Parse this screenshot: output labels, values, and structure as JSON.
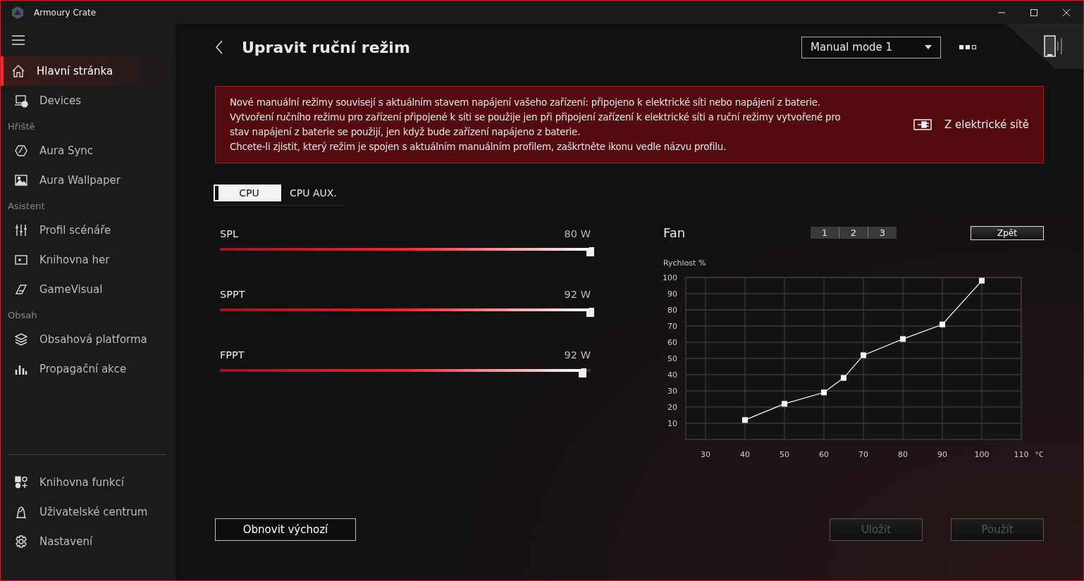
{
  "window": {
    "title": "Armoury Crate"
  },
  "sidebar": {
    "groups": [
      {
        "items": [
          {
            "label": "Hlavní stránka",
            "kind": "home",
            "selected": true
          },
          {
            "label": "Devices",
            "kind": "devices",
            "selected": false
          }
        ]
      },
      {
        "header": "Hřiště",
        "items": [
          {
            "label": "Aura Sync",
            "kind": "aura",
            "selected": false
          },
          {
            "label": "Aura Wallpaper",
            "kind": "wallpaper",
            "selected": false
          }
        ]
      },
      {
        "header": "Asistent",
        "items": [
          {
            "label": "Profil scénáře",
            "kind": "scenario",
            "selected": false
          },
          {
            "label": "Knihovna her",
            "kind": "games",
            "selected": false
          },
          {
            "label": "GameVisual",
            "kind": "visual",
            "selected": false
          }
        ]
      },
      {
        "header": "Obsah",
        "items": [
          {
            "label": "Obsahová platforma",
            "kind": "content",
            "selected": false
          },
          {
            "label": "Propagační akce",
            "kind": "promo",
            "selected": false
          }
        ]
      }
    ],
    "bottom_items": [
      {
        "label": "Knihovna funkcí",
        "kind": "features",
        "selected": false
      },
      {
        "label": "Uživatelské centrum",
        "kind": "user",
        "selected": false
      },
      {
        "label": "Nastavení",
        "kind": "settings",
        "selected": false
      }
    ]
  },
  "page": {
    "title": "Upravit ruční režim",
    "mode_dropdown": "Manual mode 1"
  },
  "notice": {
    "lines": [
      "Nové manuální režimy souvisejí s aktuálním stavem napájení vašeho zařízení: připojeno k elektrické síti nebo napájení z baterie.",
      "Vytvoření ručního režimu pro zařízení připojené k síti se použije jen při připojení zařízení k elektrické síti a ruční režimy vytvořené pro",
      "stav napájení z baterie se použijí, jen když bude zařízení napájeno z baterie.",
      "Chcete-li zjistit, který režim je spojen s aktuálním manuálním profilem, zaškrtněte ikonu vedle názvu profilu."
    ],
    "power_source": "Z elektrické sítě"
  },
  "tabs": [
    {
      "label": "CPU",
      "selected": true
    },
    {
      "label": "CPU AUX.",
      "selected": false
    }
  ],
  "sliders": [
    {
      "name": "SPL",
      "reading": "80 W",
      "level": 1.0
    },
    {
      "name": "SPPT",
      "reading": "92 W",
      "level": 1.0
    },
    {
      "name": "FPPT",
      "reading": "92 W",
      "level": 0.98
    }
  ],
  "fan": {
    "profiles": [
      {
        "label": "1",
        "selected": false
      },
      {
        "label": "2",
        "selected": false
      },
      {
        "label": "3",
        "selected": false
      }
    ],
    "back_button": "Zpět",
    "chart_data": {
      "type": "line",
      "grid": true,
      "xlabel": "°C",
      "ylabel": "Rychlost %",
      "x": [
        40,
        50,
        60,
        65,
        70,
        80,
        90,
        100
      ],
      "series": [
        {
          "name": "Fan",
          "color": "#ffffff",
          "marker": "square",
          "values": [
            12,
            22,
            29,
            38,
            52,
            62,
            71,
            98
          ]
        }
      ],
      "xlim": [
        25,
        110
      ],
      "ylim": [
        0,
        100
      ],
      "xticks": [
        30,
        40,
        50,
        60,
        70,
        80,
        90,
        100,
        110
      ],
      "yticks": [
        10,
        20,
        30,
        40,
        50,
        60,
        70,
        80,
        90,
        100
      ]
    }
  },
  "buttons": [
    {
      "label": "Obnovit výchozí",
      "disabled": false
    },
    {
      "label": "Uložit",
      "disabled": true
    },
    {
      "label": "Použít",
      "disabled": true
    }
  ]
}
